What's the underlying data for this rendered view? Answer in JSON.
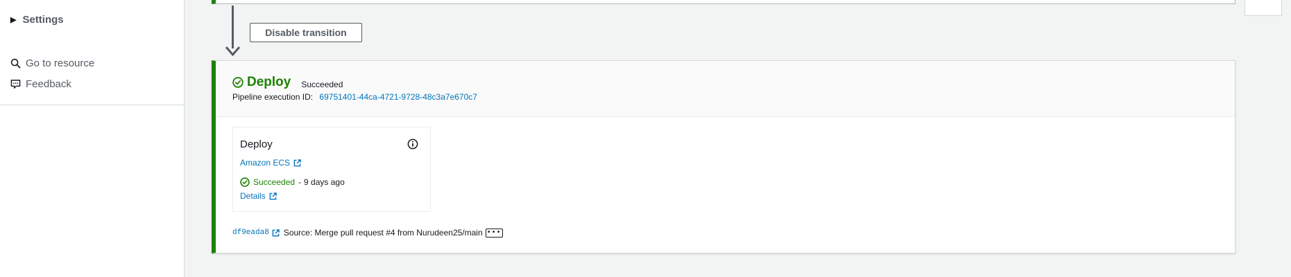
{
  "sidebar": {
    "settings_label": "Settings",
    "links": [
      {
        "label": "Go to resource",
        "icon": "search-icon"
      },
      {
        "label": "Feedback",
        "icon": "feedback-icon"
      }
    ]
  },
  "transition": {
    "disable_label": "Disable transition"
  },
  "stage": {
    "name": "Deploy",
    "status": "Succeeded",
    "execution_label": "Pipeline execution ID:",
    "execution_id": "69751401-44ca-4721-9728-48c3a7e670c7",
    "action": {
      "name": "Deploy",
      "provider": "Amazon ECS",
      "status": "Succeeded",
      "separator": "-",
      "time_ago": "9 days ago",
      "details_label": "Details"
    },
    "commit": {
      "hash": "df9eada8",
      "message": "Source: Merge pull request #4 from Nurudeen25/main",
      "more_label": "•••"
    }
  },
  "colors": {
    "success": "#1d8102",
    "link": "#0073bb",
    "border": "#d5dbdb",
    "background": "#f2f3f3"
  }
}
